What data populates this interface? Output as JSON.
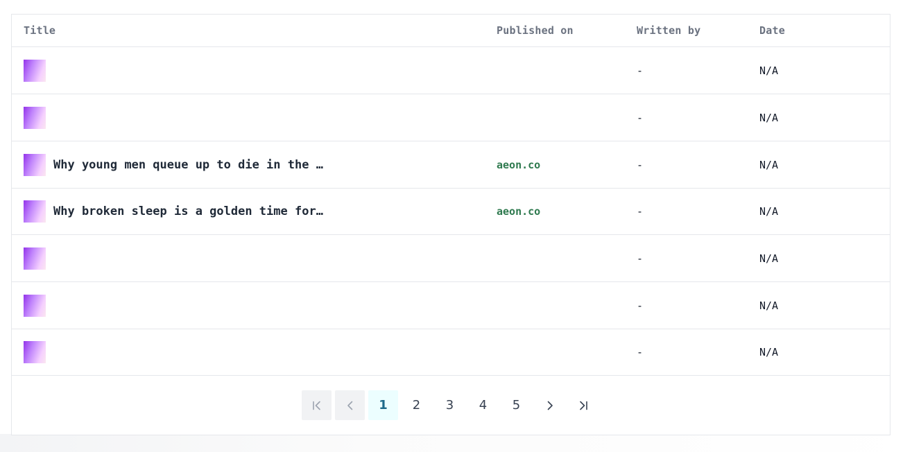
{
  "table": {
    "headers": {
      "title": "Title",
      "published_on": "Published on",
      "written_by": "Written by",
      "date": "Date"
    },
    "rows": [
      {
        "title": "",
        "published_on": "",
        "written_by": "-",
        "date": "N/A"
      },
      {
        "title": "",
        "published_on": "",
        "written_by": "-",
        "date": "N/A"
      },
      {
        "title": "Why young men queue up to die in the …",
        "published_on": "aeon.co",
        "written_by": "-",
        "date": "N/A"
      },
      {
        "title": "Why broken sleep is a golden time for…",
        "published_on": "aeon.co",
        "written_by": "-",
        "date": "N/A"
      },
      {
        "title": "",
        "published_on": "",
        "written_by": "-",
        "date": "N/A"
      },
      {
        "title": "",
        "published_on": "",
        "written_by": "-",
        "date": "N/A"
      },
      {
        "title": "",
        "published_on": "",
        "written_by": "-",
        "date": "N/A"
      }
    ]
  },
  "pagination": {
    "first_icon": "first-page-icon",
    "prev_icon": "chevron-left-icon",
    "pages": [
      "1",
      "2",
      "3",
      "4",
      "5"
    ],
    "current_page": "1",
    "next_icon": "chevron-right-icon",
    "last_icon": "last-page-icon"
  },
  "colors": {
    "source_link": "#2f7a4f",
    "active_page_bg": "#ecfeff",
    "active_page_text": "#1e6a8a",
    "disabled_button_bg": "#f1f2f4"
  }
}
